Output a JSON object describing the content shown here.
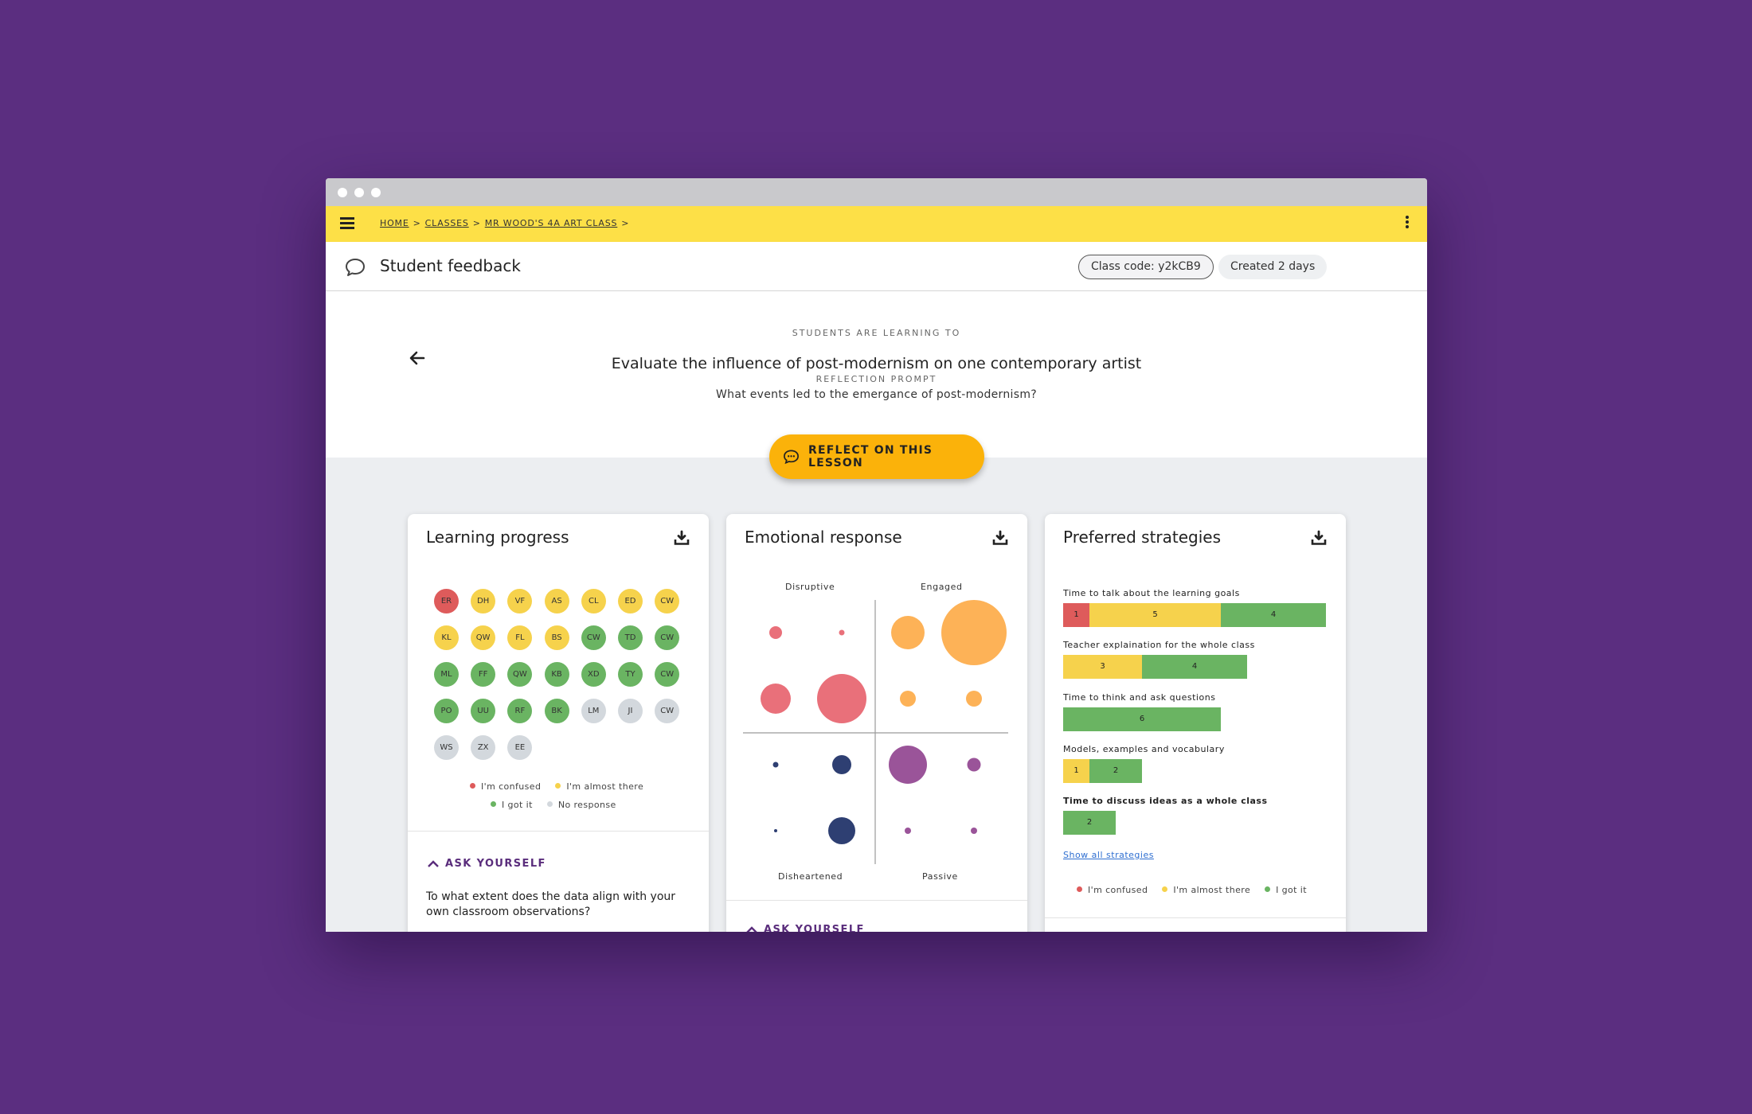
{
  "colors": {
    "background": "#5b2e80",
    "topbar": "#fde047",
    "confused": "#de5b5b",
    "almost": "#f6d24c",
    "gotit": "#6ab462",
    "noresponse": "#d3d8dd",
    "accent_button": "#fbb20a"
  },
  "breadcrumb": {
    "home": "HOME",
    "classes": "CLASSES",
    "class_name": "MR WOOD'S 4A ART CLASS",
    "sep": ">"
  },
  "header": {
    "title": "Student feedback",
    "class_code": "Class code: y2kCB9",
    "created": "Created 2 days"
  },
  "hero": {
    "eyebrow_learning": "STUDENTS ARE LEARNING TO",
    "objective": "Evaluate the influence of post-modernism on one contemporary artist",
    "eyebrow_prompt": "REFLECTION PROMPT",
    "prompt": "What events led to the emergance of post-modernism?",
    "reflect_button": "REFLECT ON THIS LESSON"
  },
  "learning_progress": {
    "title": "Learning progress",
    "students": [
      {
        "initials": "ER",
        "status": "confused"
      },
      {
        "initials": "DH",
        "status": "almost"
      },
      {
        "initials": "VF",
        "status": "almost"
      },
      {
        "initials": "AS",
        "status": "almost"
      },
      {
        "initials": "CL",
        "status": "almost"
      },
      {
        "initials": "ED",
        "status": "almost"
      },
      {
        "initials": "CW",
        "status": "almost"
      },
      {
        "initials": "KL",
        "status": "almost"
      },
      {
        "initials": "QW",
        "status": "almost"
      },
      {
        "initials": "FL",
        "status": "almost"
      },
      {
        "initials": "BS",
        "status": "almost"
      },
      {
        "initials": "CW",
        "status": "gotit"
      },
      {
        "initials": "TD",
        "status": "gotit"
      },
      {
        "initials": "CW",
        "status": "gotit"
      },
      {
        "initials": "ML",
        "status": "gotit"
      },
      {
        "initials": "FF",
        "status": "gotit"
      },
      {
        "initials": "QW",
        "status": "gotit"
      },
      {
        "initials": "KB",
        "status": "gotit"
      },
      {
        "initials": "XD",
        "status": "gotit"
      },
      {
        "initials": "TY",
        "status": "gotit"
      },
      {
        "initials": "CW",
        "status": "gotit"
      },
      {
        "initials": "PO",
        "status": "gotit"
      },
      {
        "initials": "UU",
        "status": "gotit"
      },
      {
        "initials": "RF",
        "status": "gotit"
      },
      {
        "initials": "BK",
        "status": "gotit"
      },
      {
        "initials": "LM",
        "status": "noresponse"
      },
      {
        "initials": "JI",
        "status": "noresponse"
      },
      {
        "initials": "CW",
        "status": "noresponse"
      },
      {
        "initials": "WS",
        "status": "noresponse"
      },
      {
        "initials": "ZX",
        "status": "noresponse"
      },
      {
        "initials": "EE",
        "status": "noresponse"
      }
    ],
    "legend": {
      "confused": "I'm confused",
      "almost": "I'm almost there",
      "gotit": "I got it",
      "noresponse": "No response"
    },
    "ask_label": "ASK YOURSELF",
    "ask_question": "To what extent does the data align with your own classroom observations?"
  },
  "emotional_response": {
    "title": "Emotional response",
    "labels": {
      "top_left": "Disruptive",
      "top_right": "Engaged",
      "bottom_left": "Disheartened",
      "bottom_right": "Passive"
    },
    "ask_label": "ASK YOURSELF"
  },
  "preferred_strategies": {
    "title": "Preferred strategies",
    "strategies": [
      {
        "label": "Time to talk about the learning goals",
        "confused": 1,
        "almost": 5,
        "gotit": 4
      },
      {
        "label": "Teacher explaination for the whole class",
        "confused": 0,
        "almost": 3,
        "gotit": 4
      },
      {
        "label": "Time to think and ask questions",
        "confused": 0,
        "almost": 0,
        "gotit": 6
      },
      {
        "label": "Models, examples and vocabulary",
        "confused": 0,
        "almost": 1,
        "gotit": 2
      },
      {
        "label": "Time to discuss ideas as a whole class",
        "confused": 0,
        "almost": 0,
        "gotit": 2
      }
    ],
    "show_all": "Show all strategies",
    "legend": {
      "confused": "I'm confused",
      "almost": "I'm almost there",
      "gotit": "I got it"
    }
  }
}
